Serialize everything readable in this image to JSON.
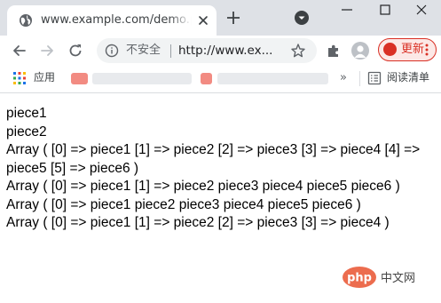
{
  "tab": {
    "title": "www.example.com/demo.php"
  },
  "toolbar": {
    "security_label": "不安全",
    "url": "http://www.ex...",
    "update_label": "更新"
  },
  "bookmarks": {
    "apps_label": "应用",
    "overflow": "»",
    "reading_list_label": "阅读清单"
  },
  "content": {
    "lines": [
      "piece1",
      "piece2",
      "Array ( [0] => piece1 [1] => piece2 [2] => piece3 [3] => piece4 [4] => piece5 [5] => piece6 )",
      "Array ( [0] => piece1 [1] => piece2 piece3 piece4 piece5 piece6 )",
      "Array ( [0] => piece1 piece2 piece3 piece4 piece5 piece6 )",
      "Array ( [0] => piece1 [1] => piece2 [2] => piece3 [3] => piece4 )"
    ]
  },
  "watermark": {
    "logo_text": "php",
    "site_name": "中文网"
  },
  "icons": {
    "favicon": "globe-icon",
    "new_tab": "plus-icon",
    "tab_search": "chevron-down-circle-icon",
    "back": "arrow-left-icon",
    "forward": "arrow-right-icon",
    "reload": "reload-icon",
    "security": "info-icon",
    "bookmark": "star-icon",
    "extensions": "puzzle-icon",
    "profile": "person-icon",
    "apps": "grid-icon",
    "reading_list": "reading-list-icon"
  },
  "colors": {
    "tab_strip": "#dee1e6",
    "omnibox": "#f1f3f4",
    "update_accent": "#d93025",
    "php_logo": "#ec6c4e"
  }
}
